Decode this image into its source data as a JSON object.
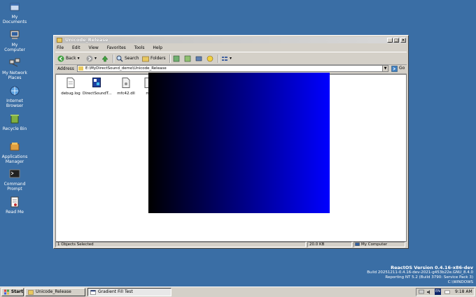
{
  "desktop": {
    "icons": [
      {
        "label_line1": "My",
        "label_line2": "Documents",
        "icon": "my-documents-icon"
      },
      {
        "label_line1": "My",
        "label_line2": "Computer",
        "icon": "my-computer-icon"
      },
      {
        "label_line1": "My Network",
        "label_line2": "Places",
        "icon": "network-places-icon"
      },
      {
        "label_line1": "Internet",
        "label_line2": "Browser",
        "icon": "internet-browser-icon"
      },
      {
        "label_line1": "Recycle Bin",
        "label_line2": "",
        "icon": "recycle-bin-icon"
      },
      {
        "label_line1": "Applications",
        "label_line2": "Manager",
        "icon": "applications-manager-icon"
      },
      {
        "label_line1": "Command",
        "label_line2": "Prompt",
        "icon": "command-prompt-icon"
      },
      {
        "label_line1": "Read Me",
        "label_line2": "",
        "icon": "read-me-icon"
      }
    ]
  },
  "window": {
    "title": "Unicode_Release",
    "menu": [
      "File",
      "Edit",
      "View",
      "Favorites",
      "Tools",
      "Help"
    ],
    "toolbar": {
      "back": "Back",
      "search": "Search",
      "folders": "Folders"
    },
    "address_label": "Address",
    "address_value": "E:\\MyDirectSound_demo\\Unicode_Release",
    "go_label": "Go",
    "files": [
      {
        "name": "debug.log",
        "icon": "log-file-icon"
      },
      {
        "name": "DirectSoundT...",
        "icon": "exe-file-icon"
      },
      {
        "name": "mfc42.dll",
        "icon": "dll-file-icon"
      },
      {
        "name": "mf",
        "icon": "dll-file-icon"
      }
    ],
    "status": {
      "selected": "1 Objects Selected",
      "size": "20.0 KB",
      "location": "My Computer"
    }
  },
  "version": {
    "line1": "ReactOS Version 0.4.16-x86-dev",
    "line2": "Build 20251211-0.4.16-dev-2021-g453b22e.GNU_8.4.0",
    "line3": "Reporting NT 5.2 (Build 3790: Service Pack 3)",
    "line4": "C:\\WINDOWS"
  },
  "taskbar": {
    "start": "Start",
    "tasks": [
      "Unicode_Release",
      "Gradient Fill Test"
    ],
    "tray_lang": "EN",
    "clock": "9:18 AM"
  },
  "colors": {
    "desktop": "#3a6ea5",
    "gradient_start": "#000000",
    "gradient_end": "#0000ff"
  }
}
